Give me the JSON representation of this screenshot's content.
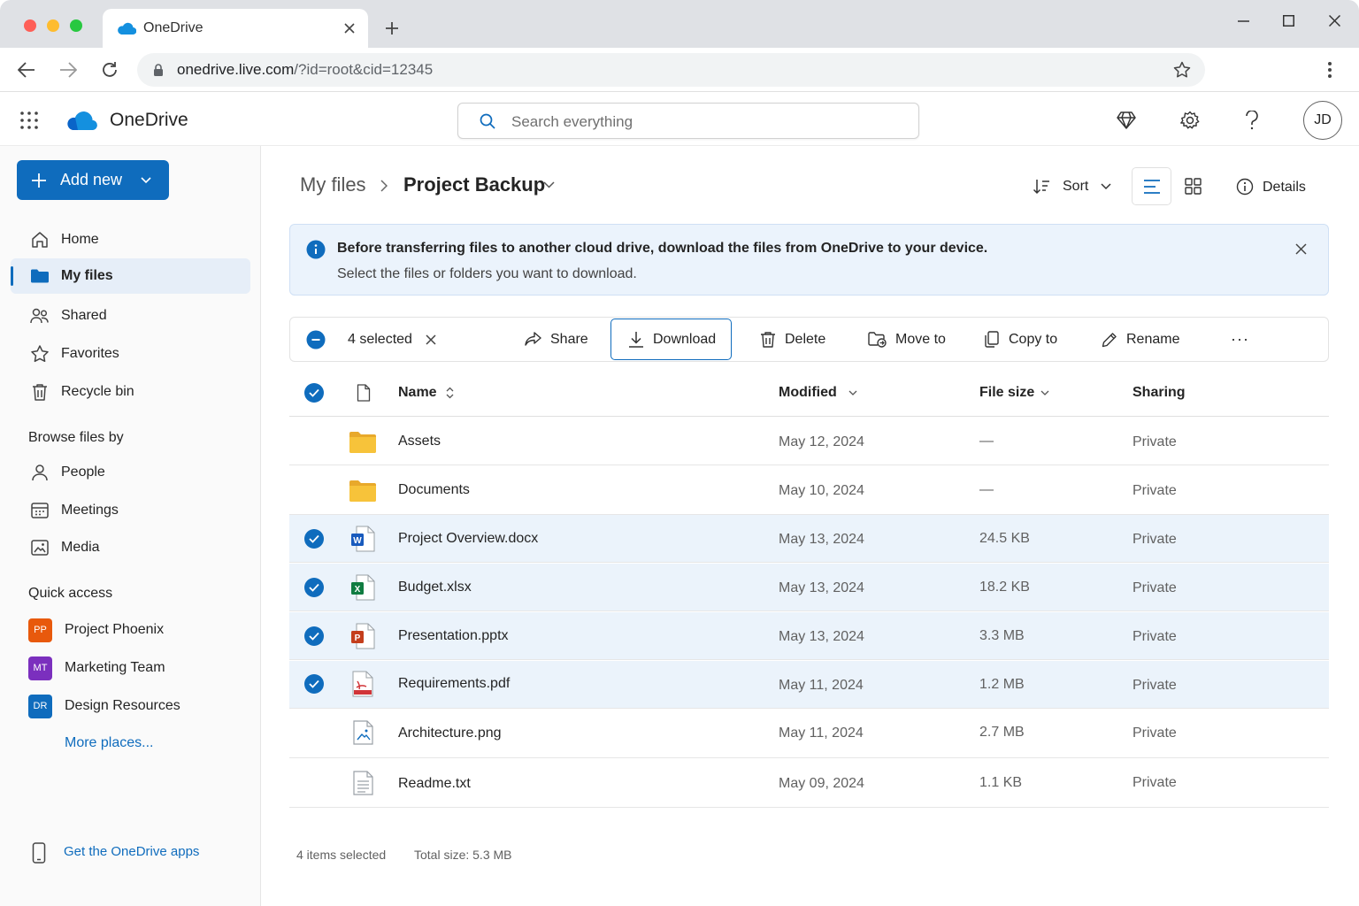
{
  "browser": {
    "tab_title": "OneDrive",
    "url_host": "onedrive.live.com",
    "url_path": "/?id=root&cid=12345"
  },
  "app": {
    "name": "OneDrive",
    "search_placeholder": "Search everything",
    "user_initials": "JD"
  },
  "sidebar": {
    "add_new_label": "Add new",
    "nav": [
      {
        "label": "Home",
        "icon": "home-icon"
      },
      {
        "label": "My files",
        "icon": "folder-icon",
        "active": true
      },
      {
        "label": "Shared",
        "icon": "people-icon"
      },
      {
        "label": "Favorites",
        "icon": "star-icon"
      },
      {
        "label": "Recycle bin",
        "icon": "trash-icon"
      }
    ],
    "browse_heading": "Browse files by",
    "browse": [
      {
        "label": "People",
        "icon": "person-icon"
      },
      {
        "label": "Meetings",
        "icon": "calendar-icon"
      },
      {
        "label": "Media",
        "icon": "image-icon"
      }
    ],
    "quick_access_heading": "Quick access",
    "quick_access": [
      {
        "initials": "PP",
        "label": "Project Phoenix",
        "color": "#e8590c"
      },
      {
        "initials": "MT",
        "label": "Marketing Team",
        "color": "#7b2fbe"
      },
      {
        "initials": "DR",
        "label": "Design Resources",
        "color": "#0f6cbd"
      }
    ],
    "more_places": "More places...",
    "get_apps": "Get the OneDrive apps"
  },
  "breadcrumb": {
    "parent": "My files",
    "current": "Project Backup"
  },
  "view_controls": {
    "sort_label": "Sort",
    "details_label": "Details"
  },
  "banner": {
    "title": "Before transferring files to another cloud drive, download the files from OneDrive to your device.",
    "body": "Select the files or folders you want to download."
  },
  "command_bar": {
    "selected_label": "4 selected",
    "share": "Share",
    "download": "Download",
    "delete": "Delete",
    "move_to": "Move to",
    "copy_to": "Copy to",
    "rename": "Rename",
    "more": "···"
  },
  "table": {
    "columns": {
      "name": "Name",
      "modified": "Modified",
      "size": "File size",
      "sharing": "Sharing"
    },
    "rows": [
      {
        "name": "Assets",
        "type": "folder",
        "modified": "May 12, 2024",
        "size": "—",
        "sharing": "Private",
        "selected": false
      },
      {
        "name": "Documents",
        "type": "folder",
        "modified": "May 10, 2024",
        "size": "—",
        "sharing": "Private",
        "selected": false
      },
      {
        "name": "Project Overview.docx",
        "type": "word",
        "modified": "May 13, 2024",
        "size": "24.5 KB",
        "sharing": "Private",
        "selected": true
      },
      {
        "name": "Budget.xlsx",
        "type": "excel",
        "modified": "May 13, 2024",
        "size": "18.2 KB",
        "sharing": "Private",
        "selected": true
      },
      {
        "name": "Presentation.pptx",
        "type": "powerpoint",
        "modified": "May 13, 2024",
        "size": "3.3 MB",
        "sharing": "Private",
        "selected": true
      },
      {
        "name": "Requirements.pdf",
        "type": "pdf",
        "modified": "May 11, 2024",
        "size": "1.2 MB",
        "sharing": "Private",
        "selected": true
      },
      {
        "name": "Architecture.png",
        "type": "image",
        "modified": "May 11, 2024",
        "size": "2.7 MB",
        "sharing": "Private",
        "selected": false
      },
      {
        "name": "Readme.txt",
        "type": "text",
        "modified": "May 09, 2024",
        "size": "1.1 KB",
        "sharing": "Private",
        "selected": false
      }
    ]
  },
  "status": {
    "items_selected": "4 items selected",
    "total_size": "Total size: 5.3 MB"
  },
  "colors": {
    "accent": "#0f6cbd",
    "selected_row": "#ebf3fb",
    "folder": "#f7c33a"
  }
}
